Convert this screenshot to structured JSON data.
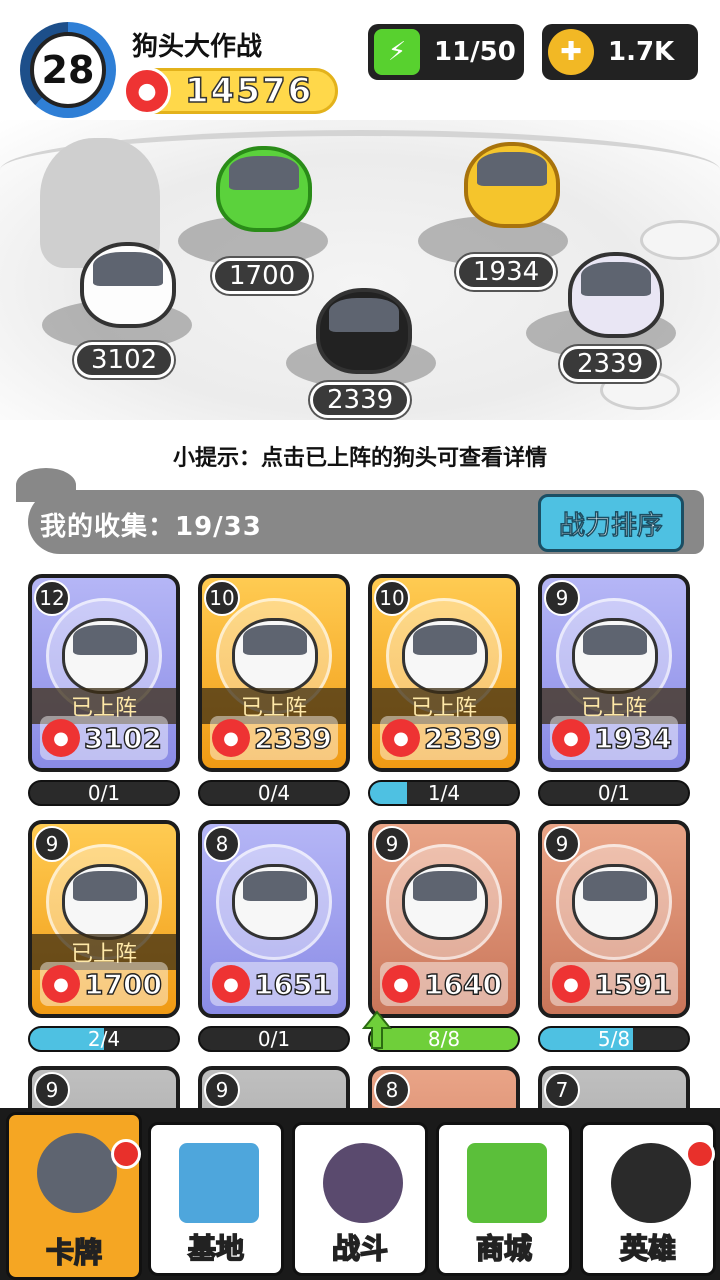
{
  "header": {
    "level": "28",
    "title": "狗头大作战",
    "power": "14576",
    "energy": "11/50",
    "coins": "1.7K"
  },
  "scene": {
    "scores": [
      "3102",
      "1700",
      "2339",
      "1934",
      "2339"
    ]
  },
  "tip": "小提示：点击已上阵的狗头可查看详情",
  "collection": {
    "label": "我的收集：19/33",
    "sort_button": "战力排序"
  },
  "cards": [
    {
      "level": "12",
      "deployed": "已上阵",
      "power": "3102",
      "progress": "0/1",
      "fill": 0
    },
    {
      "level": "10",
      "deployed": "已上阵",
      "power": "2339",
      "progress": "0/4",
      "fill": 0
    },
    {
      "level": "10",
      "deployed": "已上阵",
      "power": "2339",
      "progress": "1/4",
      "fill": 0.25
    },
    {
      "level": "9",
      "deployed": "已上阵",
      "power": "1934",
      "progress": "0/1",
      "fill": 0
    },
    {
      "level": "9",
      "deployed": "已上阵",
      "power": "1700",
      "progress": "2/4",
      "fill": 0.5
    },
    {
      "level": "8",
      "deployed": "",
      "power": "1651",
      "progress": "0/1",
      "fill": 0
    },
    {
      "level": "9",
      "deployed": "",
      "power": "1640",
      "progress": "8/8",
      "fill": 1
    },
    {
      "level": "9",
      "deployed": "",
      "power": "1591",
      "progress": "5/8",
      "fill": 0.625
    },
    {
      "level": "9"
    },
    {
      "level": "9"
    },
    {
      "level": "8"
    },
    {
      "level": "7"
    }
  ],
  "nav": [
    "卡牌",
    "基地",
    "战斗",
    "商城",
    "英雄"
  ],
  "colors": {
    "accent": "#f5a623",
    "sort_button": "#4ec1e2",
    "progress_fill": "#4ec1e2",
    "progress_full": "#6fcf3a",
    "power_pill": "#ffd84a"
  }
}
